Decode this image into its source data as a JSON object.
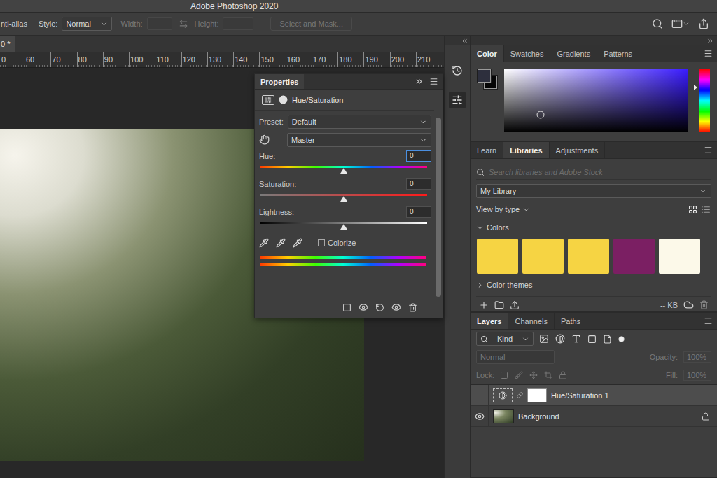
{
  "window": {
    "title": "Adobe Photoshop 2020"
  },
  "options_bar": {
    "anti_alias_label": "nti-alias",
    "style_label": "Style:",
    "style_value": "Normal",
    "width_label": "Width:",
    "height_label": "Height:",
    "size_fields_disabled": true,
    "select_and_mask": {
      "label": "Select and Mask...",
      "disabled": true
    }
  },
  "document_tabs": [
    {
      "label": "0 *",
      "selected": true
    }
  ],
  "ruler": {
    "ticks": [
      "0",
      "60",
      "70",
      "80",
      "90",
      "100",
      "110",
      "120",
      "130",
      "140",
      "150",
      "160",
      "170",
      "180",
      "190",
      "200",
      "210"
    ]
  },
  "properties": {
    "tab": "Properties",
    "adjustment": "Hue/Saturation",
    "preset": {
      "label": "Preset:",
      "value": "Default"
    },
    "range": {
      "value": "Master"
    },
    "sliders": [
      {
        "kind": "hue",
        "label": "Hue:",
        "value": "0",
        "level": 0.5,
        "focused": true
      },
      {
        "kind": "saturation",
        "label": "Saturation:",
        "value": "0",
        "level": 0.5,
        "focused": false
      },
      {
        "kind": "lightness",
        "label": "Lightness:",
        "value": "0",
        "level": 0.5,
        "focused": false
      }
    ],
    "colorize": {
      "label": "Colorize",
      "checked": false
    }
  },
  "color_panel": {
    "tabs": [
      {
        "label": "Color",
        "selected": true
      },
      {
        "label": "Swatches",
        "selected": false
      },
      {
        "label": "Gradients",
        "selected": false
      },
      {
        "label": "Patterns",
        "selected": false
      }
    ],
    "foreground": "#2d2f3d",
    "background": "#050505",
    "hue": "#3a1cff",
    "hue_level": 0.29,
    "picker_x": 0.2,
    "picker_y": 0.72
  },
  "libraries": {
    "tabs": [
      {
        "label": "Learn",
        "selected": false
      },
      {
        "label": "Libraries",
        "selected": true
      },
      {
        "label": "Adjustments",
        "selected": false
      }
    ],
    "search_placeholder": "Search libraries and Adobe Stock",
    "library": "My Library",
    "view_label": "View by type",
    "views": [
      {
        "kind": "grid",
        "selected": true
      },
      {
        "kind": "list",
        "selected": false
      }
    ],
    "sections": [
      {
        "label": "Colors",
        "expanded": true,
        "swatches": [
          {
            "color": "#f6d443"
          },
          {
            "color": "#f6d443"
          },
          {
            "color": "#f6d443"
          },
          {
            "color": "#7b1f63"
          },
          {
            "color": "#fcf9e9"
          }
        ]
      },
      {
        "label": "Color themes",
        "expanded": false,
        "swatches": []
      }
    ],
    "size": "-- KB"
  },
  "layers": {
    "tabs": [
      {
        "label": "Layers",
        "selected": true
      },
      {
        "label": "Channels",
        "selected": false
      },
      {
        "label": "Paths",
        "selected": false
      }
    ],
    "filter": "Kind",
    "blend_mode": "Normal",
    "opacity_label": "Opacity:",
    "opacity": "100%",
    "lock_label": "Lock:",
    "fill_label": "Fill:",
    "fill": "100%",
    "controls_disabled": true,
    "rows": [
      {
        "name": "Hue/Saturation 1",
        "kind": "adjustment",
        "selected": true,
        "visible": false,
        "locked": false
      },
      {
        "name": "Background",
        "kind": "image",
        "selected": false,
        "visible": true,
        "locked": true
      }
    ]
  }
}
